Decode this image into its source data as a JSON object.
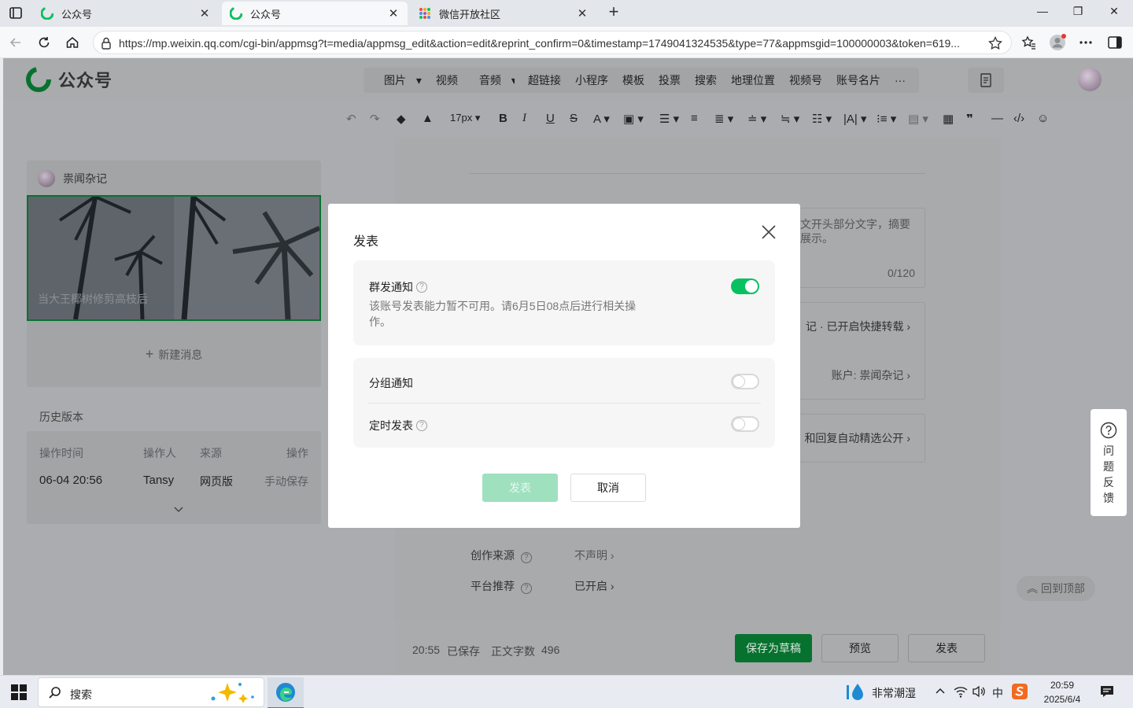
{
  "browser": {
    "tabs": [
      {
        "label": "公众号",
        "active": false
      },
      {
        "label": "公众号",
        "active": true
      },
      {
        "label": "微信开放社区",
        "active": false
      }
    ],
    "url": "https://mp.weixin.qq.com/cgi-bin/appmsg?t=media/appmsg_edit&action=edit&reprint_confirm=0&timestamp=1749041324535&type=77&appmsgid=100000003&token=619..."
  },
  "topbar": {
    "logo_text": "公众号",
    "menu_group1": [
      "图片",
      "视频",
      "音频"
    ],
    "menu_group2": [
      "超链接",
      "小程序",
      "模板",
      "投票",
      "搜索",
      "地理位置",
      "视频号",
      "账号名片",
      "···"
    ]
  },
  "toolbar": {
    "font_size": "17px"
  },
  "left": {
    "account_name": "祟闻杂记",
    "cover_caption": "当大王椰树修剪高枝后",
    "new_message": "新建消息",
    "history_title": "历史版本",
    "history_headers": [
      "操作时间",
      "操作人",
      "来源",
      "操作"
    ],
    "history_rows": [
      {
        "time": "06-04 20:56",
        "user": "Tansy",
        "source": "网页版",
        "action": "手动保存"
      }
    ]
  },
  "editor": {
    "summary_hint_line1": "文开头部分文字，摘要",
    "summary_hint_line2": "展示。",
    "summary_count": "0/120",
    "row1": "记 · 已开启快捷转载 ›",
    "row2": "账户: 祟闻杂记 ›",
    "row3": "和回复自动精选公开 ›",
    "source_label": "创作来源",
    "source_value": "不声明 ›",
    "recommend_label": "平台推荐",
    "recommend_value": "已开启 ›"
  },
  "bottom": {
    "save_time": "20:55",
    "saved": "已保存",
    "word_count_label": "正文字数",
    "word_count": "496",
    "save_draft": "保存为草稿",
    "preview": "预览",
    "publish": "发表"
  },
  "float": {
    "feedback": [
      "问",
      "题",
      "反",
      "馈"
    ],
    "back_top": "回到顶部"
  },
  "modal": {
    "title": "发表",
    "mass_notify": {
      "label": "群发通知",
      "desc": "该账号发表能力暂不可用。请6月5日08点后进行相关操作。",
      "on": true
    },
    "group_notify": {
      "label": "分组通知",
      "on": false
    },
    "scheduled": {
      "label": "定时发表",
      "on": false
    },
    "publish_btn": "发表",
    "cancel_btn": "取消"
  },
  "taskbar": {
    "search": "搜索",
    "weather": "非常潮湿",
    "ime": "中",
    "time": "20:59",
    "date": "2025/6/4"
  },
  "colors": {
    "brand_green": "#07c160",
    "dark_green": "#07722f",
    "disabled_green": "#9fe0bf"
  }
}
